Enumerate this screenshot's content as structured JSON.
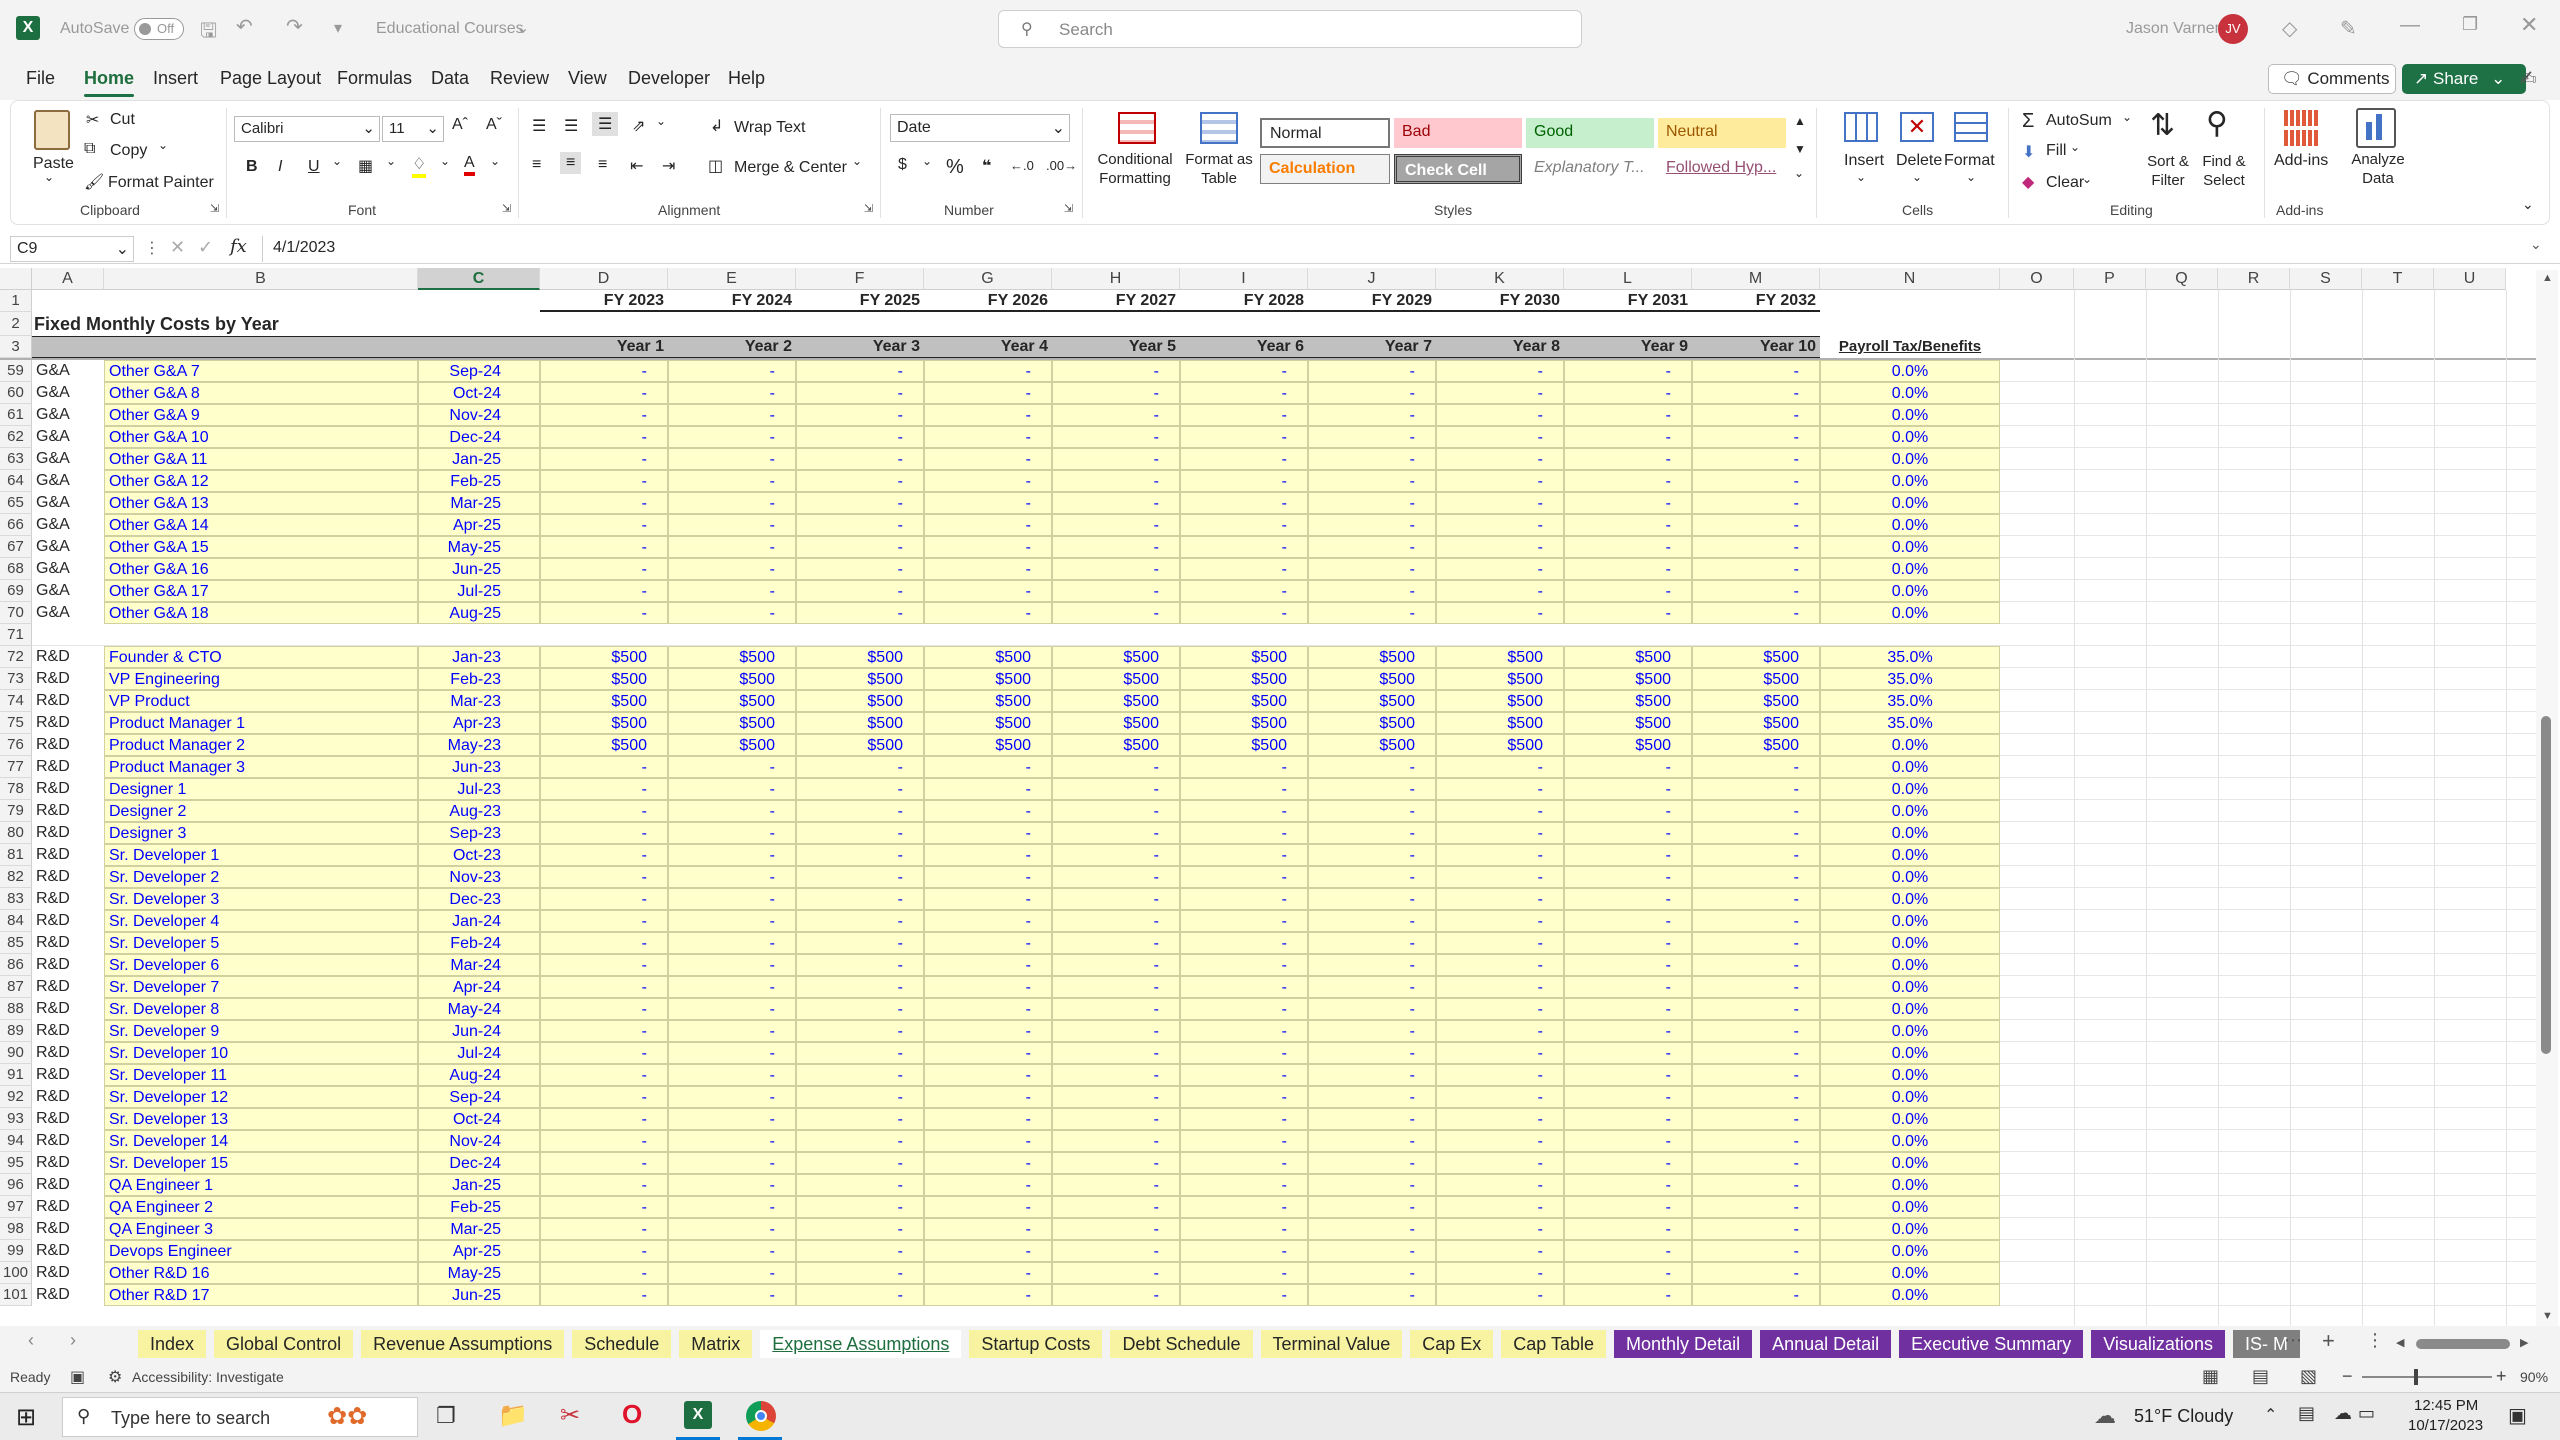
{
  "titlebar": {
    "autosave": "AutoSave",
    "autosave_state": "Off",
    "filename": "Educational Courses",
    "search_placeholder": "Search",
    "user": "Jason Varner",
    "user_initials": "JV"
  },
  "menu": [
    "File",
    "Home",
    "Insert",
    "Page Layout",
    "Formulas",
    "Data",
    "Review",
    "View",
    "Developer",
    "Help"
  ],
  "menu_active": "Home",
  "menu_right": {
    "comments": "Comments",
    "share": "Share"
  },
  "ribbon": {
    "clipboard": {
      "paste": "Paste",
      "cut": "Cut",
      "copy": "Copy",
      "format_painter": "Format Painter",
      "label": "Clipboard"
    },
    "font": {
      "name": "Calibri",
      "size": "11",
      "label": "Font"
    },
    "alignment": {
      "wrap": "Wrap Text",
      "merge": "Merge & Center",
      "label": "Alignment"
    },
    "number": {
      "format": "Date",
      "label": "Number"
    },
    "styles": {
      "cond": "Conditional Formatting",
      "fmt_table": "Format as Table",
      "label": "Styles",
      "cells": [
        {
          "t": "Normal"
        },
        {
          "t": "Bad"
        },
        {
          "t": "Good"
        },
        {
          "t": "Neutral"
        },
        {
          "t": "Calculation"
        },
        {
          "t": "Check Cell"
        },
        {
          "t": "Explanatory T..."
        },
        {
          "t": "Followed Hyp..."
        }
      ]
    },
    "cells": {
      "insert": "Insert",
      "delete": "Delete",
      "format": "Format",
      "label": "Cells"
    },
    "editing": {
      "autosum": "AutoSum",
      "fill": "Fill",
      "clear": "Clear",
      "sort": "Sort & Filter",
      "find": "Find & Select",
      "label": "Editing"
    },
    "addins": {
      "addins": "Add-ins",
      "analyze": "Analyze Data",
      "label": "Add-ins"
    }
  },
  "formula_bar": {
    "name_box": "C9",
    "fx": "fx",
    "value": "4/1/2023"
  },
  "columns": [
    "A",
    "B",
    "C",
    "D",
    "E",
    "F",
    "G",
    "H",
    "I",
    "J",
    "K",
    "L",
    "M",
    "N",
    "O",
    "P",
    "Q",
    "R",
    "S",
    "T",
    "U"
  ],
  "header_rows": {
    "fy": [
      "FY 2023",
      "FY 2024",
      "FY 2025",
      "FY 2026",
      "FY 2027",
      "FY 2028",
      "FY 2029",
      "FY 2030",
      "FY 2031",
      "FY 2032"
    ],
    "title": "Fixed Monthly Costs by Year",
    "years": [
      "Year 1",
      "Year 2",
      "Year 3",
      "Year 4",
      "Year 5",
      "Year 6",
      "Year 7",
      "Year 8",
      "Year 9",
      "Year 10"
    ],
    "payroll": "Payroll Tax/Benefits",
    "row_numbers": [
      "1",
      "2",
      "3"
    ]
  },
  "rows": [
    {
      "n": "59",
      "a": "G&A",
      "b": "Other G&A 7",
      "c": "Sep-24",
      "v": "-",
      "p": "0.0%"
    },
    {
      "n": "60",
      "a": "G&A",
      "b": "Other G&A 8",
      "c": "Oct-24",
      "v": "-",
      "p": "0.0%"
    },
    {
      "n": "61",
      "a": "G&A",
      "b": "Other G&A 9",
      "c": "Nov-24",
      "v": "-",
      "p": "0.0%"
    },
    {
      "n": "62",
      "a": "G&A",
      "b": "Other G&A 10",
      "c": "Dec-24",
      "v": "-",
      "p": "0.0%"
    },
    {
      "n": "63",
      "a": "G&A",
      "b": "Other G&A 11",
      "c": "Jan-25",
      "v": "-",
      "p": "0.0%"
    },
    {
      "n": "64",
      "a": "G&A",
      "b": "Other G&A 12",
      "c": "Feb-25",
      "v": "-",
      "p": "0.0%"
    },
    {
      "n": "65",
      "a": "G&A",
      "b": "Other G&A 13",
      "c": "Mar-25",
      "v": "-",
      "p": "0.0%"
    },
    {
      "n": "66",
      "a": "G&A",
      "b": "Other G&A 14",
      "c": "Apr-25",
      "v": "-",
      "p": "0.0%"
    },
    {
      "n": "67",
      "a": "G&A",
      "b": "Other G&A 15",
      "c": "May-25",
      "v": "-",
      "p": "0.0%"
    },
    {
      "n": "68",
      "a": "G&A",
      "b": "Other G&A 16",
      "c": "Jun-25",
      "v": "-",
      "p": "0.0%"
    },
    {
      "n": "69",
      "a": "G&A",
      "b": "Other G&A 17",
      "c": "Jul-25",
      "v": "-",
      "p": "0.0%"
    },
    {
      "n": "70",
      "a": "G&A",
      "b": "Other G&A 18",
      "c": "Aug-25",
      "v": "-",
      "p": "0.0%"
    },
    {
      "n": "71",
      "a": "",
      "b": "",
      "c": "",
      "v": "",
      "p": ""
    },
    {
      "n": "72",
      "a": "R&D",
      "b": "Founder & CTO",
      "c": "Jan-23",
      "v": "$500",
      "p": "35.0%"
    },
    {
      "n": "73",
      "a": "R&D",
      "b": "VP Engineering",
      "c": "Feb-23",
      "v": "$500",
      "p": "35.0%"
    },
    {
      "n": "74",
      "a": "R&D",
      "b": "VP Product",
      "c": "Mar-23",
      "v": "$500",
      "p": "35.0%"
    },
    {
      "n": "75",
      "a": "R&D",
      "b": "Product Manager 1",
      "c": "Apr-23",
      "v": "$500",
      "p": "35.0%"
    },
    {
      "n": "76",
      "a": "R&D",
      "b": "Product Manager 2",
      "c": "May-23",
      "v": "$500",
      "p": "0.0%"
    },
    {
      "n": "77",
      "a": "R&D",
      "b": "Product Manager 3",
      "c": "Jun-23",
      "v": "-",
      "p": "0.0%"
    },
    {
      "n": "78",
      "a": "R&D",
      "b": "Designer 1",
      "c": "Jul-23",
      "v": "-",
      "p": "0.0%"
    },
    {
      "n": "79",
      "a": "R&D",
      "b": "Designer 2",
      "c": "Aug-23",
      "v": "-",
      "p": "0.0%"
    },
    {
      "n": "80",
      "a": "R&D",
      "b": "Designer 3",
      "c": "Sep-23",
      "v": "-",
      "p": "0.0%"
    },
    {
      "n": "81",
      "a": "R&D",
      "b": "Sr. Developer 1",
      "c": "Oct-23",
      "v": "-",
      "p": "0.0%"
    },
    {
      "n": "82",
      "a": "R&D",
      "b": "Sr. Developer 2",
      "c": "Nov-23",
      "v": "-",
      "p": "0.0%"
    },
    {
      "n": "83",
      "a": "R&D",
      "b": "Sr. Developer 3",
      "c": "Dec-23",
      "v": "-",
      "p": "0.0%"
    },
    {
      "n": "84",
      "a": "R&D",
      "b": "Sr. Developer 4",
      "c": "Jan-24",
      "v": "-",
      "p": "0.0%"
    },
    {
      "n": "85",
      "a": "R&D",
      "b": "Sr. Developer 5",
      "c": "Feb-24",
      "v": "-",
      "p": "0.0%"
    },
    {
      "n": "86",
      "a": "R&D",
      "b": "Sr. Developer 6",
      "c": "Mar-24",
      "v": "-",
      "p": "0.0%"
    },
    {
      "n": "87",
      "a": "R&D",
      "b": "Sr. Developer 7",
      "c": "Apr-24",
      "v": "-",
      "p": "0.0%"
    },
    {
      "n": "88",
      "a": "R&D",
      "b": "Sr. Developer 8",
      "c": "May-24",
      "v": "-",
      "p": "0.0%"
    },
    {
      "n": "89",
      "a": "R&D",
      "b": "Sr. Developer 9",
      "c": "Jun-24",
      "v": "-",
      "p": "0.0%"
    },
    {
      "n": "90",
      "a": "R&D",
      "b": "Sr. Developer 10",
      "c": "Jul-24",
      "v": "-",
      "p": "0.0%"
    },
    {
      "n": "91",
      "a": "R&D",
      "b": "Sr. Developer 11",
      "c": "Aug-24",
      "v": "-",
      "p": "0.0%"
    },
    {
      "n": "92",
      "a": "R&D",
      "b": "Sr. Developer 12",
      "c": "Sep-24",
      "v": "-",
      "p": "0.0%"
    },
    {
      "n": "93",
      "a": "R&D",
      "b": "Sr. Developer 13",
      "c": "Oct-24",
      "v": "-",
      "p": "0.0%"
    },
    {
      "n": "94",
      "a": "R&D",
      "b": "Sr. Developer 14",
      "c": "Nov-24",
      "v": "-",
      "p": "0.0%"
    },
    {
      "n": "95",
      "a": "R&D",
      "b": "Sr. Developer 15",
      "c": "Dec-24",
      "v": "-",
      "p": "0.0%"
    },
    {
      "n": "96",
      "a": "R&D",
      "b": "QA Engineer 1",
      "c": "Jan-25",
      "v": "-",
      "p": "0.0%"
    },
    {
      "n": "97",
      "a": "R&D",
      "b": "QA Engineer 2",
      "c": "Feb-25",
      "v": "-",
      "p": "0.0%"
    },
    {
      "n": "98",
      "a": "R&D",
      "b": "QA Engineer 3",
      "c": "Mar-25",
      "v": "-",
      "p": "0.0%"
    },
    {
      "n": "99",
      "a": "R&D",
      "b": "Devops Engineer",
      "c": "Apr-25",
      "v": "-",
      "p": "0.0%"
    },
    {
      "n": "100",
      "a": "R&D",
      "b": "Other R&D 16",
      "c": "May-25",
      "v": "-",
      "p": "0.0%"
    },
    {
      "n": "101",
      "a": "R&D",
      "b": "Other R&D 17",
      "c": "Jun-25",
      "v": "-",
      "p": "0.0%"
    }
  ],
  "sheet_tabs": [
    {
      "t": "Index",
      "k": "y"
    },
    {
      "t": "Global Control",
      "k": "y"
    },
    {
      "t": "Revenue Assumptions",
      "k": "y"
    },
    {
      "t": "Schedule",
      "k": "y"
    },
    {
      "t": "Matrix",
      "k": "y"
    },
    {
      "t": "Expense Assumptions",
      "k": "sel"
    },
    {
      "t": "Startup Costs",
      "k": "y"
    },
    {
      "t": "Debt Schedule",
      "k": "y"
    },
    {
      "t": "Terminal Value",
      "k": "y"
    },
    {
      "t": "Cap Ex",
      "k": "y"
    },
    {
      "t": "Cap Table",
      "k": "y"
    },
    {
      "t": "Monthly Detail",
      "k": "p"
    },
    {
      "t": "Annual Detail",
      "k": "p"
    },
    {
      "t": "Executive Summary",
      "k": "p"
    },
    {
      "t": "Visualizations",
      "k": "p"
    },
    {
      "t": "IS- M",
      "k": "g"
    }
  ],
  "status": {
    "ready": "Ready",
    "accessibility": "Accessibility: Investigate",
    "zoom": "90%"
  },
  "taskbar": {
    "search_placeholder": "Type here to search",
    "weather": "51°F  Cloudy",
    "time": "12:45 PM",
    "date": "10/17/2023"
  }
}
